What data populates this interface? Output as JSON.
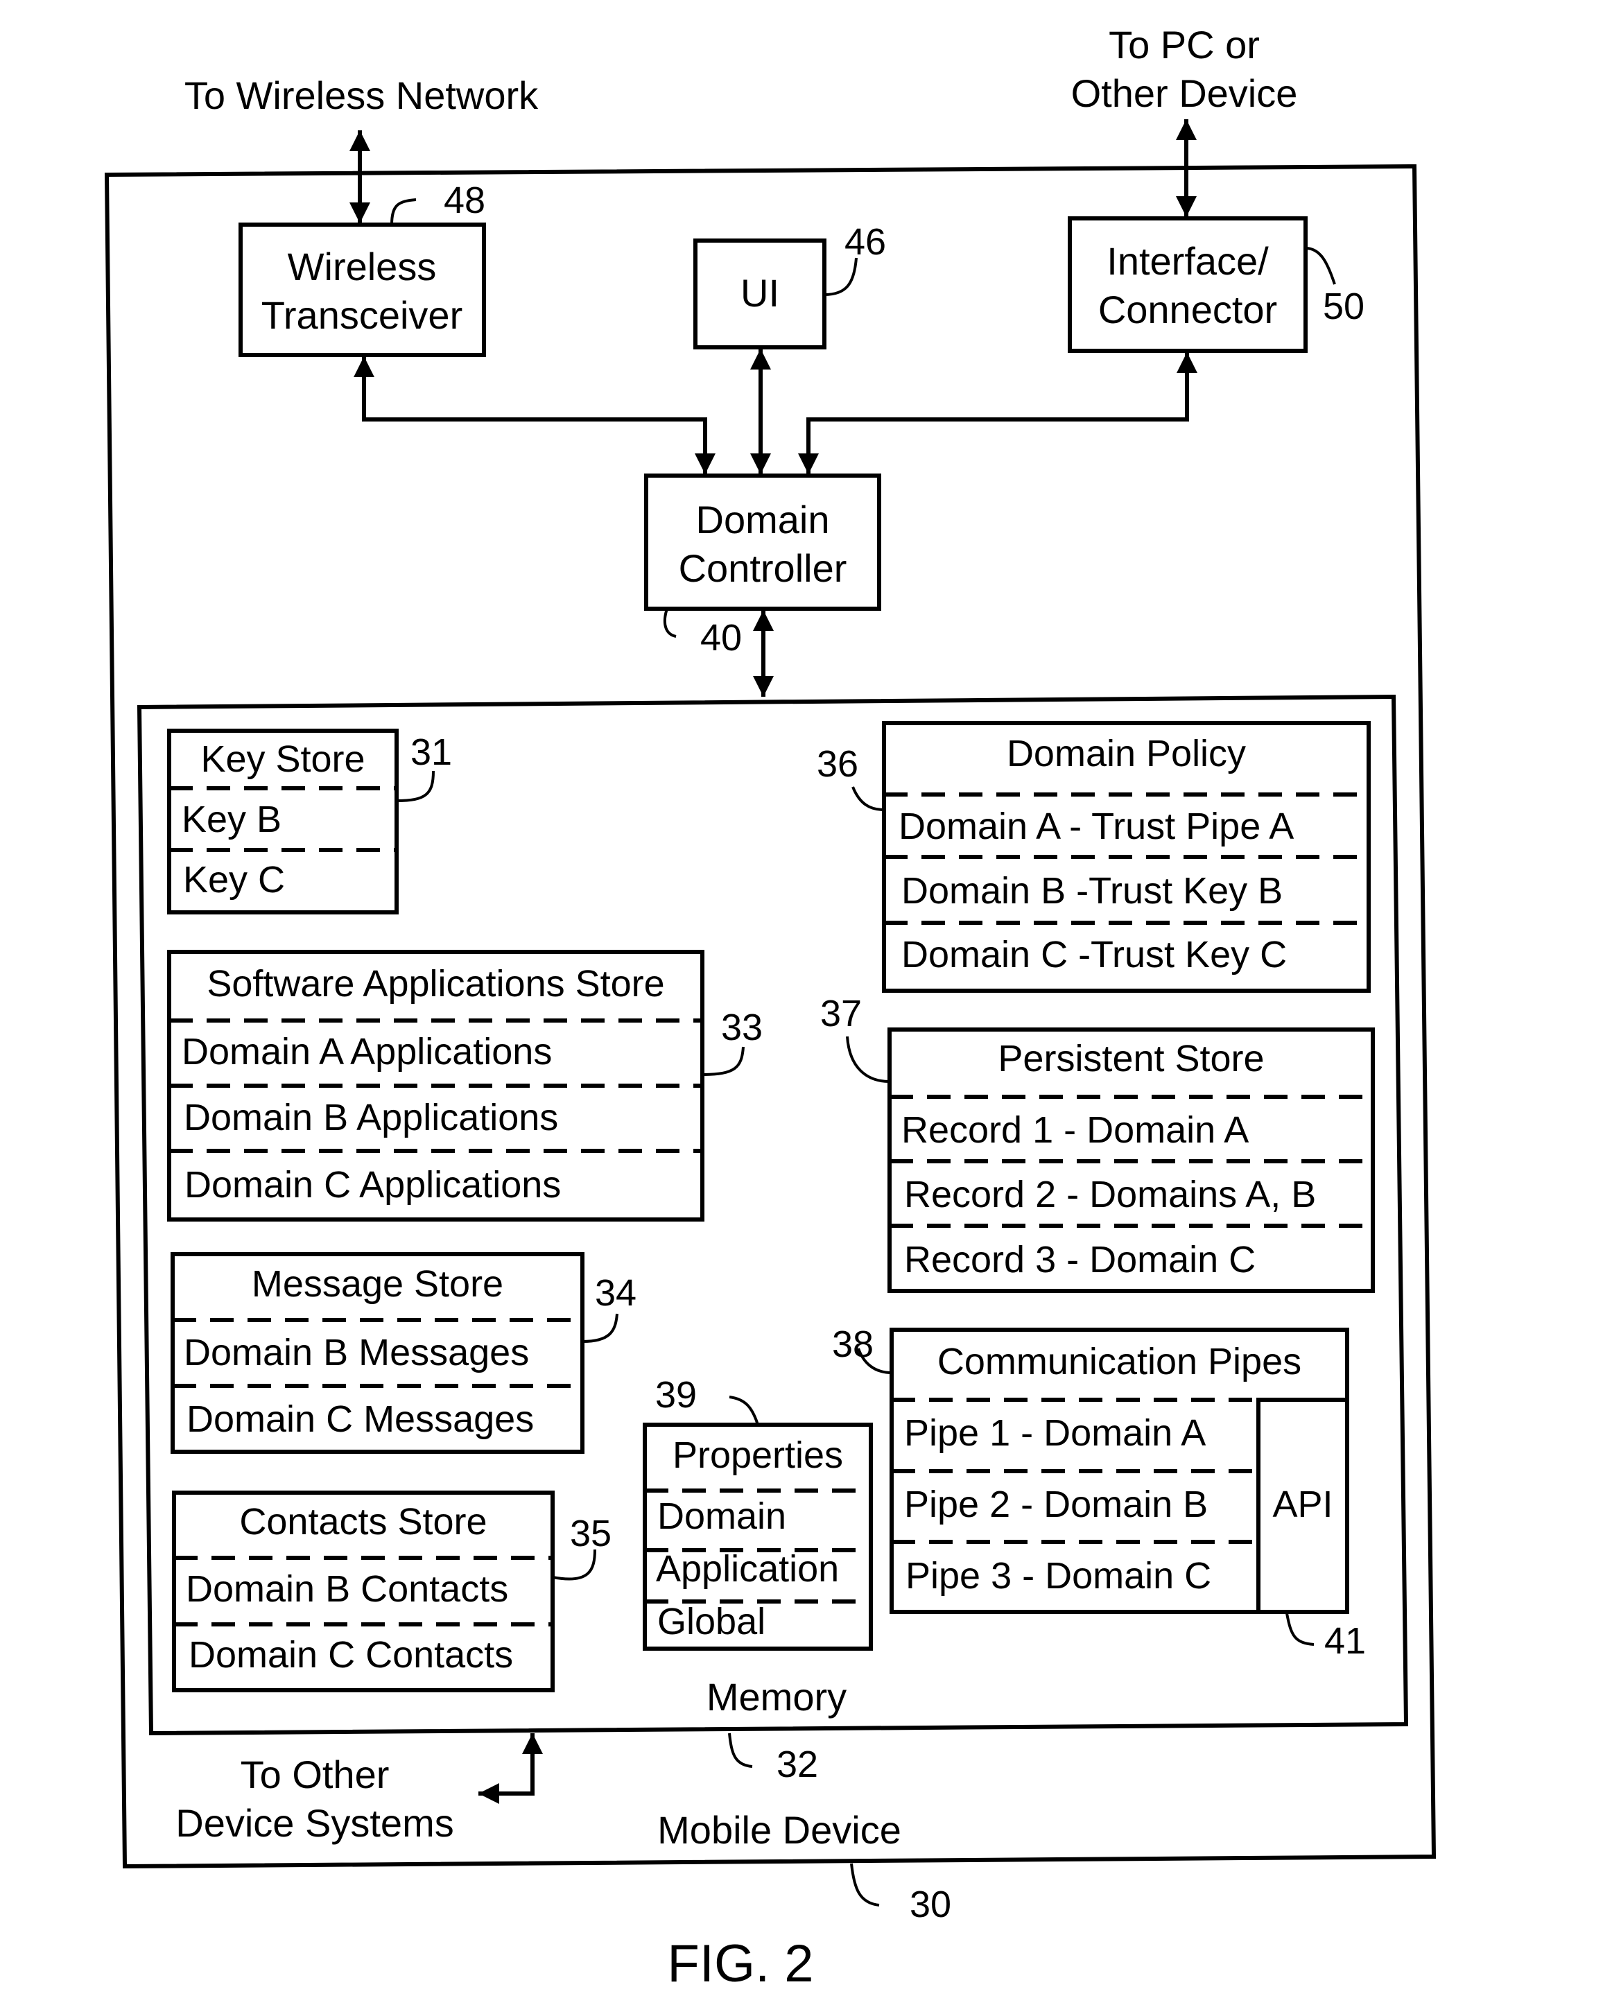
{
  "figure": {
    "caption": "FIG. 2",
    "external": {
      "wireless_network": "To Wireless Network",
      "pc_line1": "To PC or",
      "pc_line2": "Other Device",
      "other_systems_line1": "To Other",
      "other_systems_line2": "Device Systems"
    },
    "device": {
      "label": "Mobile Device",
      "ref": "30"
    },
    "top_blocks": {
      "wireless": {
        "line1": "Wireless",
        "line2": "Transceiver",
        "ref": "48"
      },
      "ui": {
        "label": "UI",
        "ref": "46"
      },
      "interface": {
        "line1": "Interface/",
        "line2": "Connector",
        "ref": "50"
      },
      "controller": {
        "line1": "Domain",
        "line2": "Controller",
        "ref": "40"
      }
    },
    "memory": {
      "label": "Memory",
      "ref": "32",
      "key_store": {
        "title": "Key Store",
        "ref": "31",
        "rows": [
          "Key B",
          "Key C"
        ]
      },
      "software_store": {
        "title": "Software Applications Store",
        "ref": "33",
        "rows": [
          "Domain A Applications",
          "Domain B Applications",
          "Domain C Applications"
        ]
      },
      "message_store": {
        "title": "Message Store",
        "ref": "34",
        "rows": [
          "Domain B Messages",
          "Domain C Messages"
        ]
      },
      "contacts_store": {
        "title": "Contacts Store",
        "ref": "35",
        "rows": [
          "Domain B Contacts",
          "Domain C Contacts"
        ]
      },
      "domain_policy": {
        "title": "Domain Policy",
        "ref": "36",
        "rows": [
          "Domain A - Trust Pipe A",
          "Domain B -Trust Key B",
          "Domain C -Trust Key C"
        ]
      },
      "persistent_store": {
        "title": "Persistent Store",
        "ref": "37",
        "rows": [
          "Record 1 - Domain A",
          "Record 2 - Domains A, B",
          "Record 3 - Domain C"
        ]
      },
      "comm_pipes": {
        "title": "Communication Pipes",
        "ref": "38",
        "rows": [
          "Pipe 1 - Domain A",
          "Pipe 2 - Domain B",
          "Pipe 3 - Domain C"
        ],
        "api_label": "API",
        "api_ref": "41"
      },
      "properties": {
        "title": "Properties",
        "ref": "39",
        "rows": [
          "Domain",
          "Application",
          "Global"
        ]
      }
    }
  }
}
